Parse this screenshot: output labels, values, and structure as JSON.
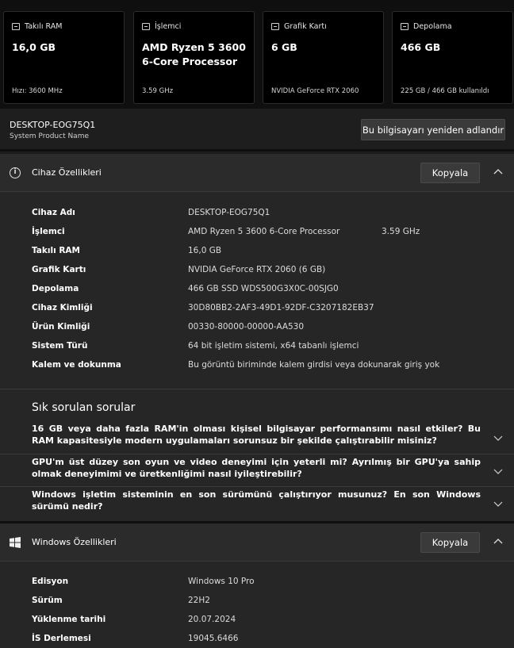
{
  "cards": [
    {
      "icon": "ram-icon",
      "label": "Takılı RAM",
      "value": "16,0 GB",
      "sub": "Hızı: 3600 MHz"
    },
    {
      "icon": "processor-icon",
      "label": "İşlemci",
      "value": "AMD Ryzen 5 3600 6-Core Processor",
      "sub": "3.59 GHz"
    },
    {
      "icon": "graphics-card-icon",
      "label": "Grafik Kartı",
      "value": "6 GB",
      "sub": "NVIDIA GeForce RTX 2060"
    },
    {
      "icon": "storage-icon",
      "label": "Depolama",
      "value": "466 GB",
      "sub": "225 GB / 466 GB kullanıldı"
    }
  ],
  "device": {
    "name": "DESKTOP-EOG75Q1",
    "model": "System Product Name",
    "rename_label": "Bu bilgisayarı yeniden adlandır"
  },
  "device_specs": {
    "title": "Cihaz Özellikleri",
    "copy_label": "Kopyala",
    "rows": [
      {
        "key": "Cihaz Adı",
        "value": "DESKTOP-EOG75Q1",
        "extra": ""
      },
      {
        "key": "İşlemci",
        "value": "AMD Ryzen 5 3600 6-Core Processor",
        "extra": "3.59 GHz"
      },
      {
        "key": "Takılı RAM",
        "value": "16,0 GB",
        "extra": ""
      },
      {
        "key": "Grafik Kartı",
        "value": "NVIDIA GeForce RTX 2060 (6 GB)",
        "extra": ""
      },
      {
        "key": "Depolama",
        "value": "466 GB SSD WDS500G3X0C-00SJG0",
        "extra": ""
      },
      {
        "key": "Cihaz Kimliği",
        "value": "30D80BB2-2AF3-49D1-92DF-C3207182EB37",
        "extra": ""
      },
      {
        "key": "Ürün Kimliği",
        "value": "00330-80000-00000-AA530",
        "extra": ""
      },
      {
        "key": "Sistem Türü",
        "value": "64 bit işletim sistemi, x64 tabanlı işlemci",
        "extra": ""
      },
      {
        "key": "Kalem ve dokunma",
        "value": "Bu görüntü biriminde kalem girdisi veya dokunarak giriş yok",
        "extra": ""
      }
    ]
  },
  "faq": {
    "title": "Sık sorulan sorular",
    "items": [
      "16 GB veya daha fazla RAM'in olması kişisel bilgisayar performansımı nasıl etkiler? Bu RAM kapasitesiyle modern uygulamaları sorunsuz bir şekilde çalıştırabilir misiniz?",
      "GPU'm üst düzey son oyun ve video deneyimi için yeterli mi? Ayrılmış bir GPU'ya sahip olmak deneyimimi ve üretkenliğimi nasıl iyileştirebilir?",
      "Windows işletim sisteminin en son sürümünü çalıştırıyor musunuz? En son Windows sürümü nedir?"
    ]
  },
  "windows_specs": {
    "title": "Windows Özellikleri",
    "copy_label": "Kopyala",
    "rows": [
      {
        "key": "Edisyon",
        "value": "Windows 10 Pro"
      },
      {
        "key": "Sürüm",
        "value": "22H2"
      },
      {
        "key": "Yüklenme tarihi",
        "value": "20.07.2024"
      },
      {
        "key": "İS Derlemesi",
        "value": "19045.6466"
      }
    ]
  }
}
